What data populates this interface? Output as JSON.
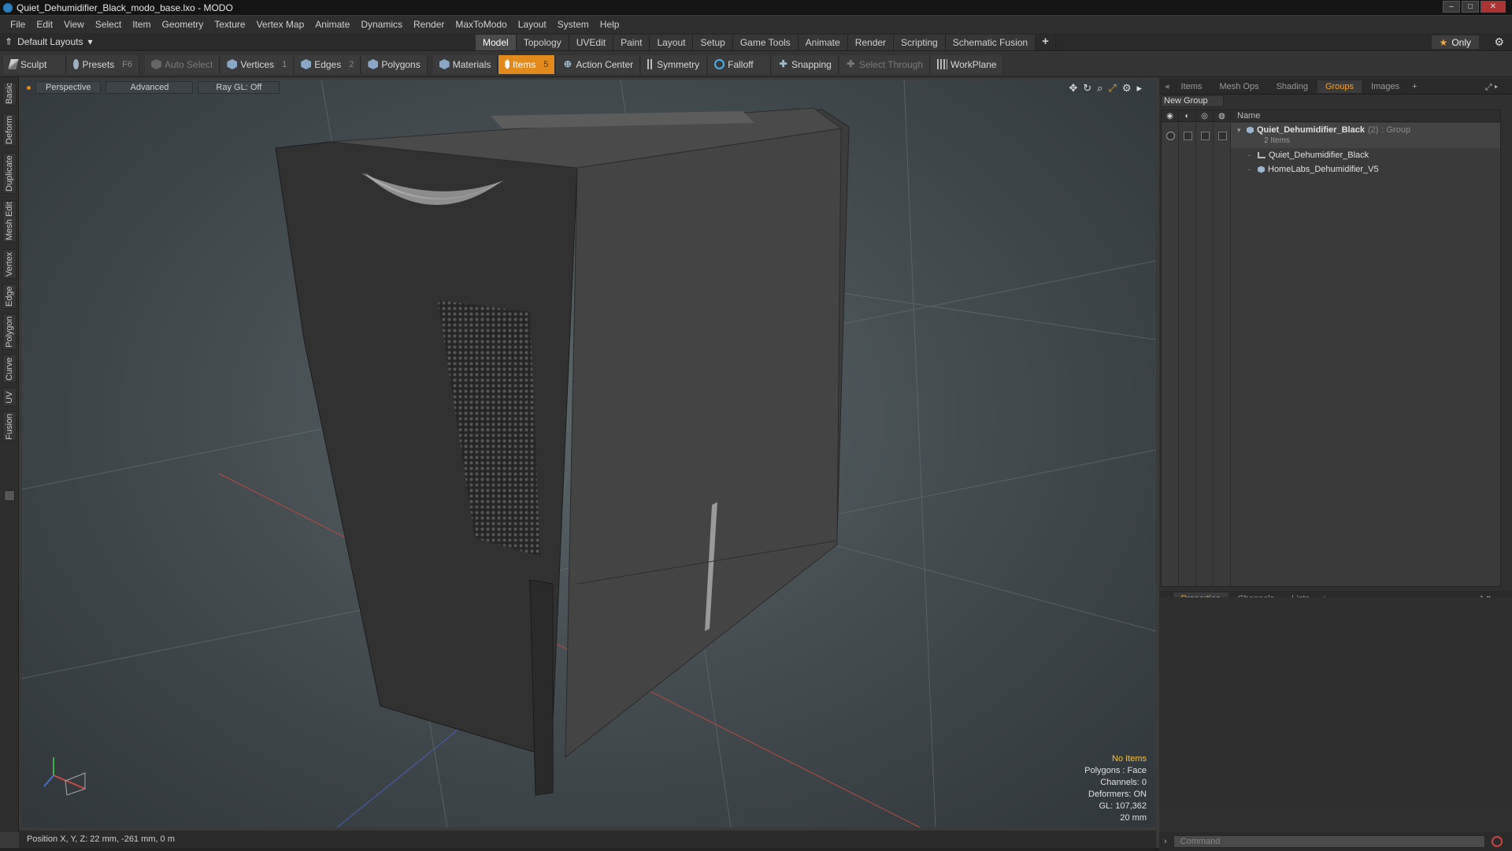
{
  "window": {
    "title": "Quiet_Dehumidifier_Black_modo_base.lxo - MODO",
    "controls": [
      "–",
      "□",
      "✕"
    ]
  },
  "menu": [
    "File",
    "Edit",
    "View",
    "Select",
    "Item",
    "Geometry",
    "Texture",
    "Vertex Map",
    "Animate",
    "Dynamics",
    "Render",
    "MaxToModo",
    "Layout",
    "System",
    "Help"
  ],
  "layouts": {
    "label": "Default Layouts"
  },
  "mode_tabs": [
    "Model",
    "Topology",
    "UVEdit",
    "Paint",
    "Layout",
    "Setup",
    "Game Tools",
    "Animate",
    "Render",
    "Scripting",
    "Schematic Fusion"
  ],
  "mode_tabs_plus": "+",
  "active_mode": "Model",
  "only_button": {
    "label": "Only",
    "icon": "star-icon"
  },
  "toolbar": {
    "sculpt": "Sculpt",
    "presets": "Presets",
    "presets_key": "F6",
    "auto_select": "Auto Select",
    "vertices": "Vertices",
    "vertices_num": "1",
    "edges": "Edges",
    "edges_num": "2",
    "polygons": "Polygons",
    "materials": "Materials",
    "items": "Items",
    "items_num": "5",
    "action_center": "Action Center",
    "symmetry": "Symmetry",
    "falloff": "Falloff",
    "snapping": "Snapping",
    "select_through": "Select Through",
    "workplane": "WorkPlane"
  },
  "left_tabs": [
    "Basic",
    "Deform",
    "Duplicate",
    "Mesh Edit",
    "Vertex",
    "Edge",
    "Polygon",
    "Curve",
    "UV",
    "Fusion"
  ],
  "viewport": {
    "view": "Perspective",
    "shading": "Advanced",
    "raygl": "Ray GL: Off",
    "info": {
      "selection": "No Items",
      "polygons": "Polygons : Face",
      "channels": "Channels: 0",
      "deformers": "Deformers: ON",
      "gl": "GL: 107,362",
      "scale": "20 mm"
    }
  },
  "groups_panel": {
    "tabs": [
      "Items",
      "Mesh Ops",
      "Shading",
      "Groups",
      "Images"
    ],
    "active_tab": "Groups",
    "new_group": "New Group",
    "name_header": "Name",
    "group_name": "Quiet_Dehumidifier_Black",
    "group_count": "(2)",
    "group_type": ": Group",
    "group_items": "2 Items",
    "children": [
      "Quiet_Dehumidifier_Black",
      "HomeLabs_Dehumidifier_V5"
    ]
  },
  "properties_panel": {
    "tabs": [
      "Properties",
      "Channels",
      "Lists"
    ],
    "active_tab": "Properties"
  },
  "status": {
    "position": "Position X, Y, Z:  22 mm, -261 mm, 0 m"
  },
  "command": {
    "placeholder": "Command"
  },
  "colors": {
    "accent": "#e38a1d",
    "tab_active": "#f0a030",
    "info_highlight": "#f2c141"
  }
}
